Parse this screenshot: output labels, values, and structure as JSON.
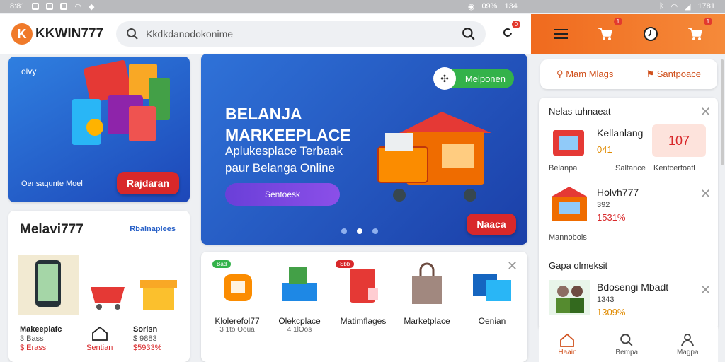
{
  "status_bar": {
    "time_left": "8:81",
    "battery": "09%",
    "signal_text": "134",
    "time_right": "1781"
  },
  "header": {
    "brand": "KKWIN777",
    "logo_letter": "K",
    "search_value": "Kkdkdanodokonime",
    "bell_badge": "0"
  },
  "header_right": {
    "cart1_badge": "1",
    "cart2_badge": "1"
  },
  "promo_left": {
    "tag": "olvy",
    "caption": "Oensaqunte Moel",
    "button": "Rajdaran"
  },
  "banner": {
    "title_line1": "BELANJA",
    "title_line2": "MARKEEPLACE",
    "subtitle_line1": "Aplukesplace Terbaak",
    "subtitle_line2": "paur Belanga Online",
    "cta": "Sentoesk",
    "pill": "Melponen",
    "corner_button": "Naaca",
    "slides": 3
  },
  "melavi": {
    "title": "Melavi777",
    "link": "Rbalnaplees",
    "items": [
      {
        "title": "Makeeplafc",
        "price": "3 Bass",
        "rate": "$ Erass"
      },
      {
        "title": "",
        "price": "",
        "rate": "Sentian"
      },
      {
        "title": "Sorisn",
        "price": "$ 9883",
        "rate": "$5933%"
      }
    ]
  },
  "products": {
    "tags": [
      "Bad",
      "Sbb"
    ],
    "items": [
      {
        "label": "Klolerefol77",
        "sub": "3 1to Ooua"
      },
      {
        "label": "Olekcplace",
        "sub": "4 1lOos"
      },
      {
        "label": "Matimflages",
        "sub": ""
      },
      {
        "label": "Marketplace",
        "sub": ""
      },
      {
        "label": "Oenian",
        "sub": ""
      }
    ]
  },
  "filters": {
    "left": "Mam Mlags",
    "right": "Santpoace"
  },
  "notifications": {
    "section1": "Nelas tuhnaeat",
    "row1": {
      "title": "Kellanlang",
      "value": "041",
      "tile": "107",
      "labels": [
        "Belanpa",
        "Saltance",
        "Kentcerfoafl"
      ]
    },
    "row2": {
      "title": "Holvh777",
      "value": "392",
      "pct": "1531%",
      "label": "Mannobols"
    },
    "section2": "Gapa olmeksit",
    "row3": {
      "title": "Bdosengi Mbadt",
      "value": "1343",
      "pct": "1309%"
    }
  },
  "bottom_nav": [
    {
      "label": "Haain"
    },
    {
      "label": "Bempa"
    },
    {
      "label": "Magpa"
    }
  ],
  "colors": {
    "accent": "#f06a1e",
    "red": "#d8282a",
    "blue": "#1b3fa8",
    "green": "#33b24a"
  }
}
